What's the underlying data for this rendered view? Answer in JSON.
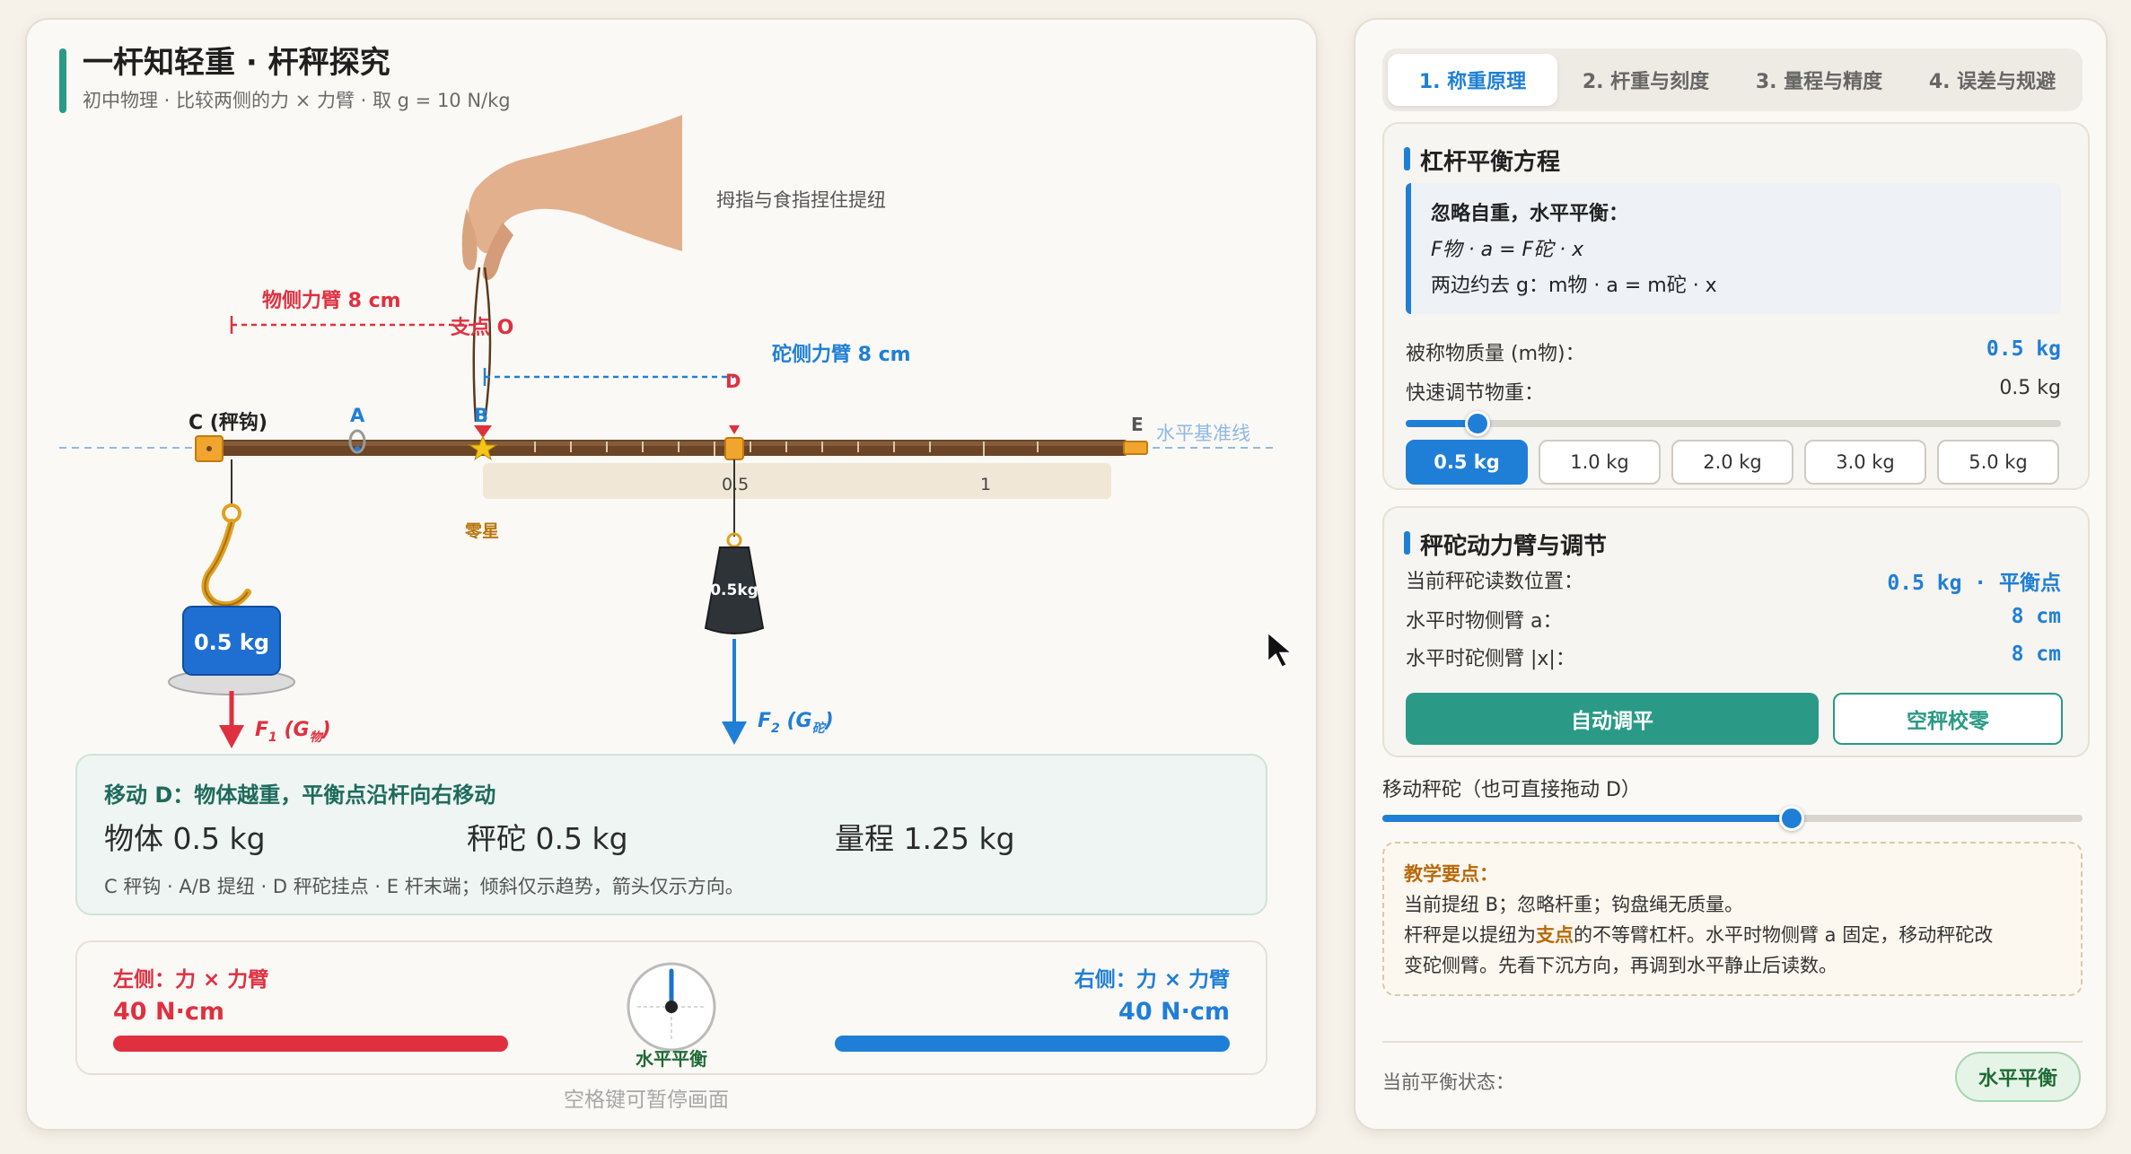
{
  "header": {
    "title": "一杆知轻重 · 杆秤探究",
    "subtitle": "初中物理 · 比较两侧的力 × 力臂 · 取 g = 10 N/kg"
  },
  "scene": {
    "hand_caption": "拇指与食指捏住提纽",
    "obj_arm_label": "物侧力臂 8 cm",
    "fulcrum_label": "支点 O",
    "weight_arm_label": "砣侧力臂 8 cm",
    "point_c": "C (秤钩)",
    "point_a": "A",
    "point_b": "B",
    "point_d": "D",
    "point_e": "E",
    "baseline_label": "水平基准线",
    "tick_05": "0.5",
    "tick_1": "1",
    "zero_star": "零星",
    "object_mass": "0.5 kg",
    "counterweight_mass": "0.5kg",
    "f1_main": "F",
    "f1_sub": "1",
    "f1_g": "(G",
    "f1_gsub": "物",
    "f2_main": "F",
    "f2_sub": "2",
    "f2_g": "(G",
    "f2_gsub": "砣"
  },
  "info": {
    "title": "移动 D：物体越重，平衡点沿杆向右移动",
    "object": "物体 0.5 kg",
    "counterweight": "秤砣 0.5 kg",
    "range": "量程 1.25 kg",
    "note": "C 秤钩 · A/B 提纽 · D 秤砣挂点 · E 杆末端；倾斜仅示趋势，箭头仅示方向。"
  },
  "moments": {
    "left_label": "左侧：力 × 力臂",
    "left_value": "40 N·cm",
    "right_label": "右侧：力 × 力臂",
    "right_value": "40 N·cm",
    "balance_label": "水平平衡",
    "left_fraction": 1.0,
    "right_fraction": 1.0
  },
  "pause_hint": "空格键可暂停画面",
  "tabs": [
    {
      "label": "1. 称重原理",
      "active": true
    },
    {
      "label": "2. 杆重与刻度",
      "active": false
    },
    {
      "label": "3. 量程与精度",
      "active": false
    },
    {
      "label": "4. 误差与规避",
      "active": false
    }
  ],
  "equation_card": {
    "title": "杠杆平衡方程",
    "line1": "忽略自重，水平平衡：",
    "line2": "F物 · a = F砣 · x",
    "line3": "两边约去 g：m物 · a = m砣 · x",
    "mass_label": "被称物质量 (m物)：",
    "mass_value": "0.5 kg",
    "quick_label": "快速调节物重：",
    "quick_value": "0.5 kg",
    "quick_slider_fraction": 0.11,
    "chips": [
      "0.5 kg",
      "1.0 kg",
      "2.0 kg",
      "3.0 kg",
      "5.0 kg"
    ],
    "active_chip": 0
  },
  "counter_card": {
    "title": "秤砣动力臂与调节",
    "reading_label": "当前秤砣读数位置：",
    "reading_value": "0.5 kg · 平衡点",
    "obj_arm_label": "水平时物侧臂 a：",
    "obj_arm_value": "8 cm",
    "cw_arm_label": "水平时砣侧臂 |x|：",
    "cw_arm_value": "8 cm",
    "auto_button": "自动调平",
    "zero_button": "空秤校零"
  },
  "move_slider": {
    "label": "移动秤砣（也可直接拖动 D）",
    "fraction": 0.584
  },
  "tip": {
    "title": "教学要点：",
    "line1": "当前提纽 B；忽略杆重；钩盘绳无质量。",
    "line2a": "杆秤是以提纽为",
    "line2b": "支点",
    "line2c": "的不等臂杠杆。水平时物侧臂 a 固定，移动秤砣改",
    "line3": "变砣侧臂。先看下沉方向，再调到水平静止后读数。"
  },
  "status": {
    "label": "当前平衡状态：",
    "value": "水平平衡"
  },
  "colors": {
    "accent_blue": "#1f7fd6",
    "accent_red": "#e03040",
    "accent_teal": "#2a9a86",
    "balance_green": "#1f6b35"
  }
}
